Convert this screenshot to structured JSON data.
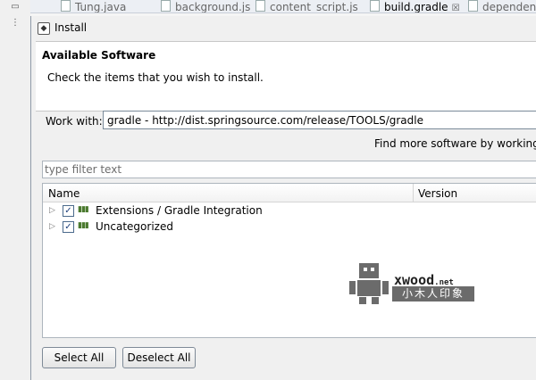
{
  "editor": {
    "tabs": [
      {
        "label": "Tung.java",
        "active": false
      },
      {
        "label": "background.js",
        "active": false
      },
      {
        "label": "content_script.js",
        "active": false
      },
      {
        "label": "build.gradle",
        "active": true
      },
      {
        "label": "dependenci",
        "active": false
      }
    ],
    "close_glyph": "☒"
  },
  "dialog": {
    "title": "Install",
    "page_title": "Available Software",
    "page_description": "Check the items that you wish to install.",
    "work_with_label": "Work with:",
    "work_with_value": "gradle - http://dist.springsource.com/release/TOOLS/gradle",
    "find_more_text": "Find more software by working wi",
    "filter_placeholder": "type filter text",
    "table": {
      "columns": [
        "Name",
        "Version"
      ],
      "rows": [
        {
          "label": "Extensions / Gradle Integration",
          "checked": true
        },
        {
          "label": "Uncategorized",
          "checked": true
        }
      ]
    },
    "buttons": {
      "select_all": "Select All",
      "deselect_all": "Deselect All"
    }
  },
  "watermark": {
    "brand": "xwood",
    "brand_suffix": ".net",
    "subtitle": "小木人印象"
  },
  "colors": {
    "dialog_bg": "#f0f0f0",
    "checkbox_border": "#4b6a8c",
    "watermark_gray": "#6b6b6b"
  }
}
